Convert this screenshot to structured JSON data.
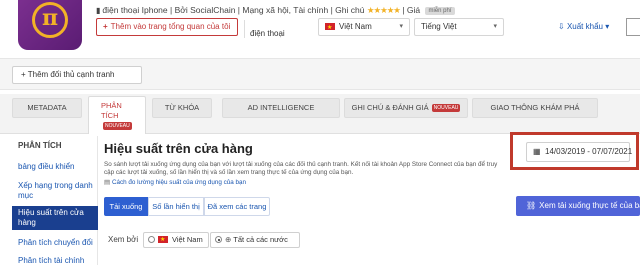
{
  "app": {
    "icon_name": "pi-network-logo",
    "icon_glyph": "π",
    "device": "điện thoại Iphone",
    "developer": "Bởi SocialChain",
    "category": "Mạng xã hội, Tài chính",
    "notes_label": "Ghi chú",
    "stars": "★★★★★",
    "price_label": "Giá",
    "price_value": "miễn phí"
  },
  "header": {
    "add_home_label": "Thêm vào trang tổng quan của tôi",
    "device_label": "điện thoại",
    "country": "Việt Nam",
    "language": "Tiếng Việt",
    "export_label": "Xuất khẩu"
  },
  "competitors": {
    "add_label": "+ Thêm đối thủ cạnh tranh"
  },
  "tabs": [
    {
      "label": "METADATA"
    },
    {
      "label_line1": "PHÂN",
      "label_line2": "TÍCH",
      "badge": "NOUVEAU"
    },
    {
      "label": "TỪ KHÓA"
    },
    {
      "label": "AD INTELLIGENCE"
    },
    {
      "label": "GHI CHÚ & ĐÁNH GIÁ",
      "badge": "NOUVEAU"
    },
    {
      "label": "GIAO THÔNG KHÁM PHÁ"
    }
  ],
  "sidebar": {
    "heading": "PHÂN TÍCH",
    "items": [
      {
        "label": "bảng điều khiển"
      },
      {
        "label": "Xếp hạng trong danh mục"
      },
      {
        "label": "Hiệu suất trên cửa hàng"
      },
      {
        "label": "Phân tích chuyển đổi"
      },
      {
        "label": "Phân tích tài chính"
      }
    ]
  },
  "main": {
    "title": "Hiệu suất trên cửa hàng",
    "description": "So sánh lượt tải xuống ứng dụng của bạn với lượt tải xuống của các đối thủ cạnh tranh. Kết nối tài khoản App Store Connect của bạn để truy cập các lượt tải xuống, số lần hiển thị và số lần xem trang thực tế của ứng dụng của bạn.",
    "help_link": "Cách đo lường hiệu suất của ứng dụng của bạn",
    "date_range": "14/03/2019 - 07/07/2021",
    "segments": [
      "Tải xuống",
      "Số lần hiển thị",
      "Đã xem các trang"
    ],
    "real_downloads_label": "Xem tải xuống thực tế của bạn",
    "view_by_label": "Xem bởi",
    "view_options": [
      {
        "label": "Việt Nam",
        "selected": false
      },
      {
        "label": "Tất cả các nước",
        "selected": true
      }
    ]
  },
  "colors": {
    "brand_red": "#c43a3a",
    "active_sidebar": "#1a3f8f",
    "primary_button": "#5064d8",
    "highlight_frame": "#c0392b"
  }
}
